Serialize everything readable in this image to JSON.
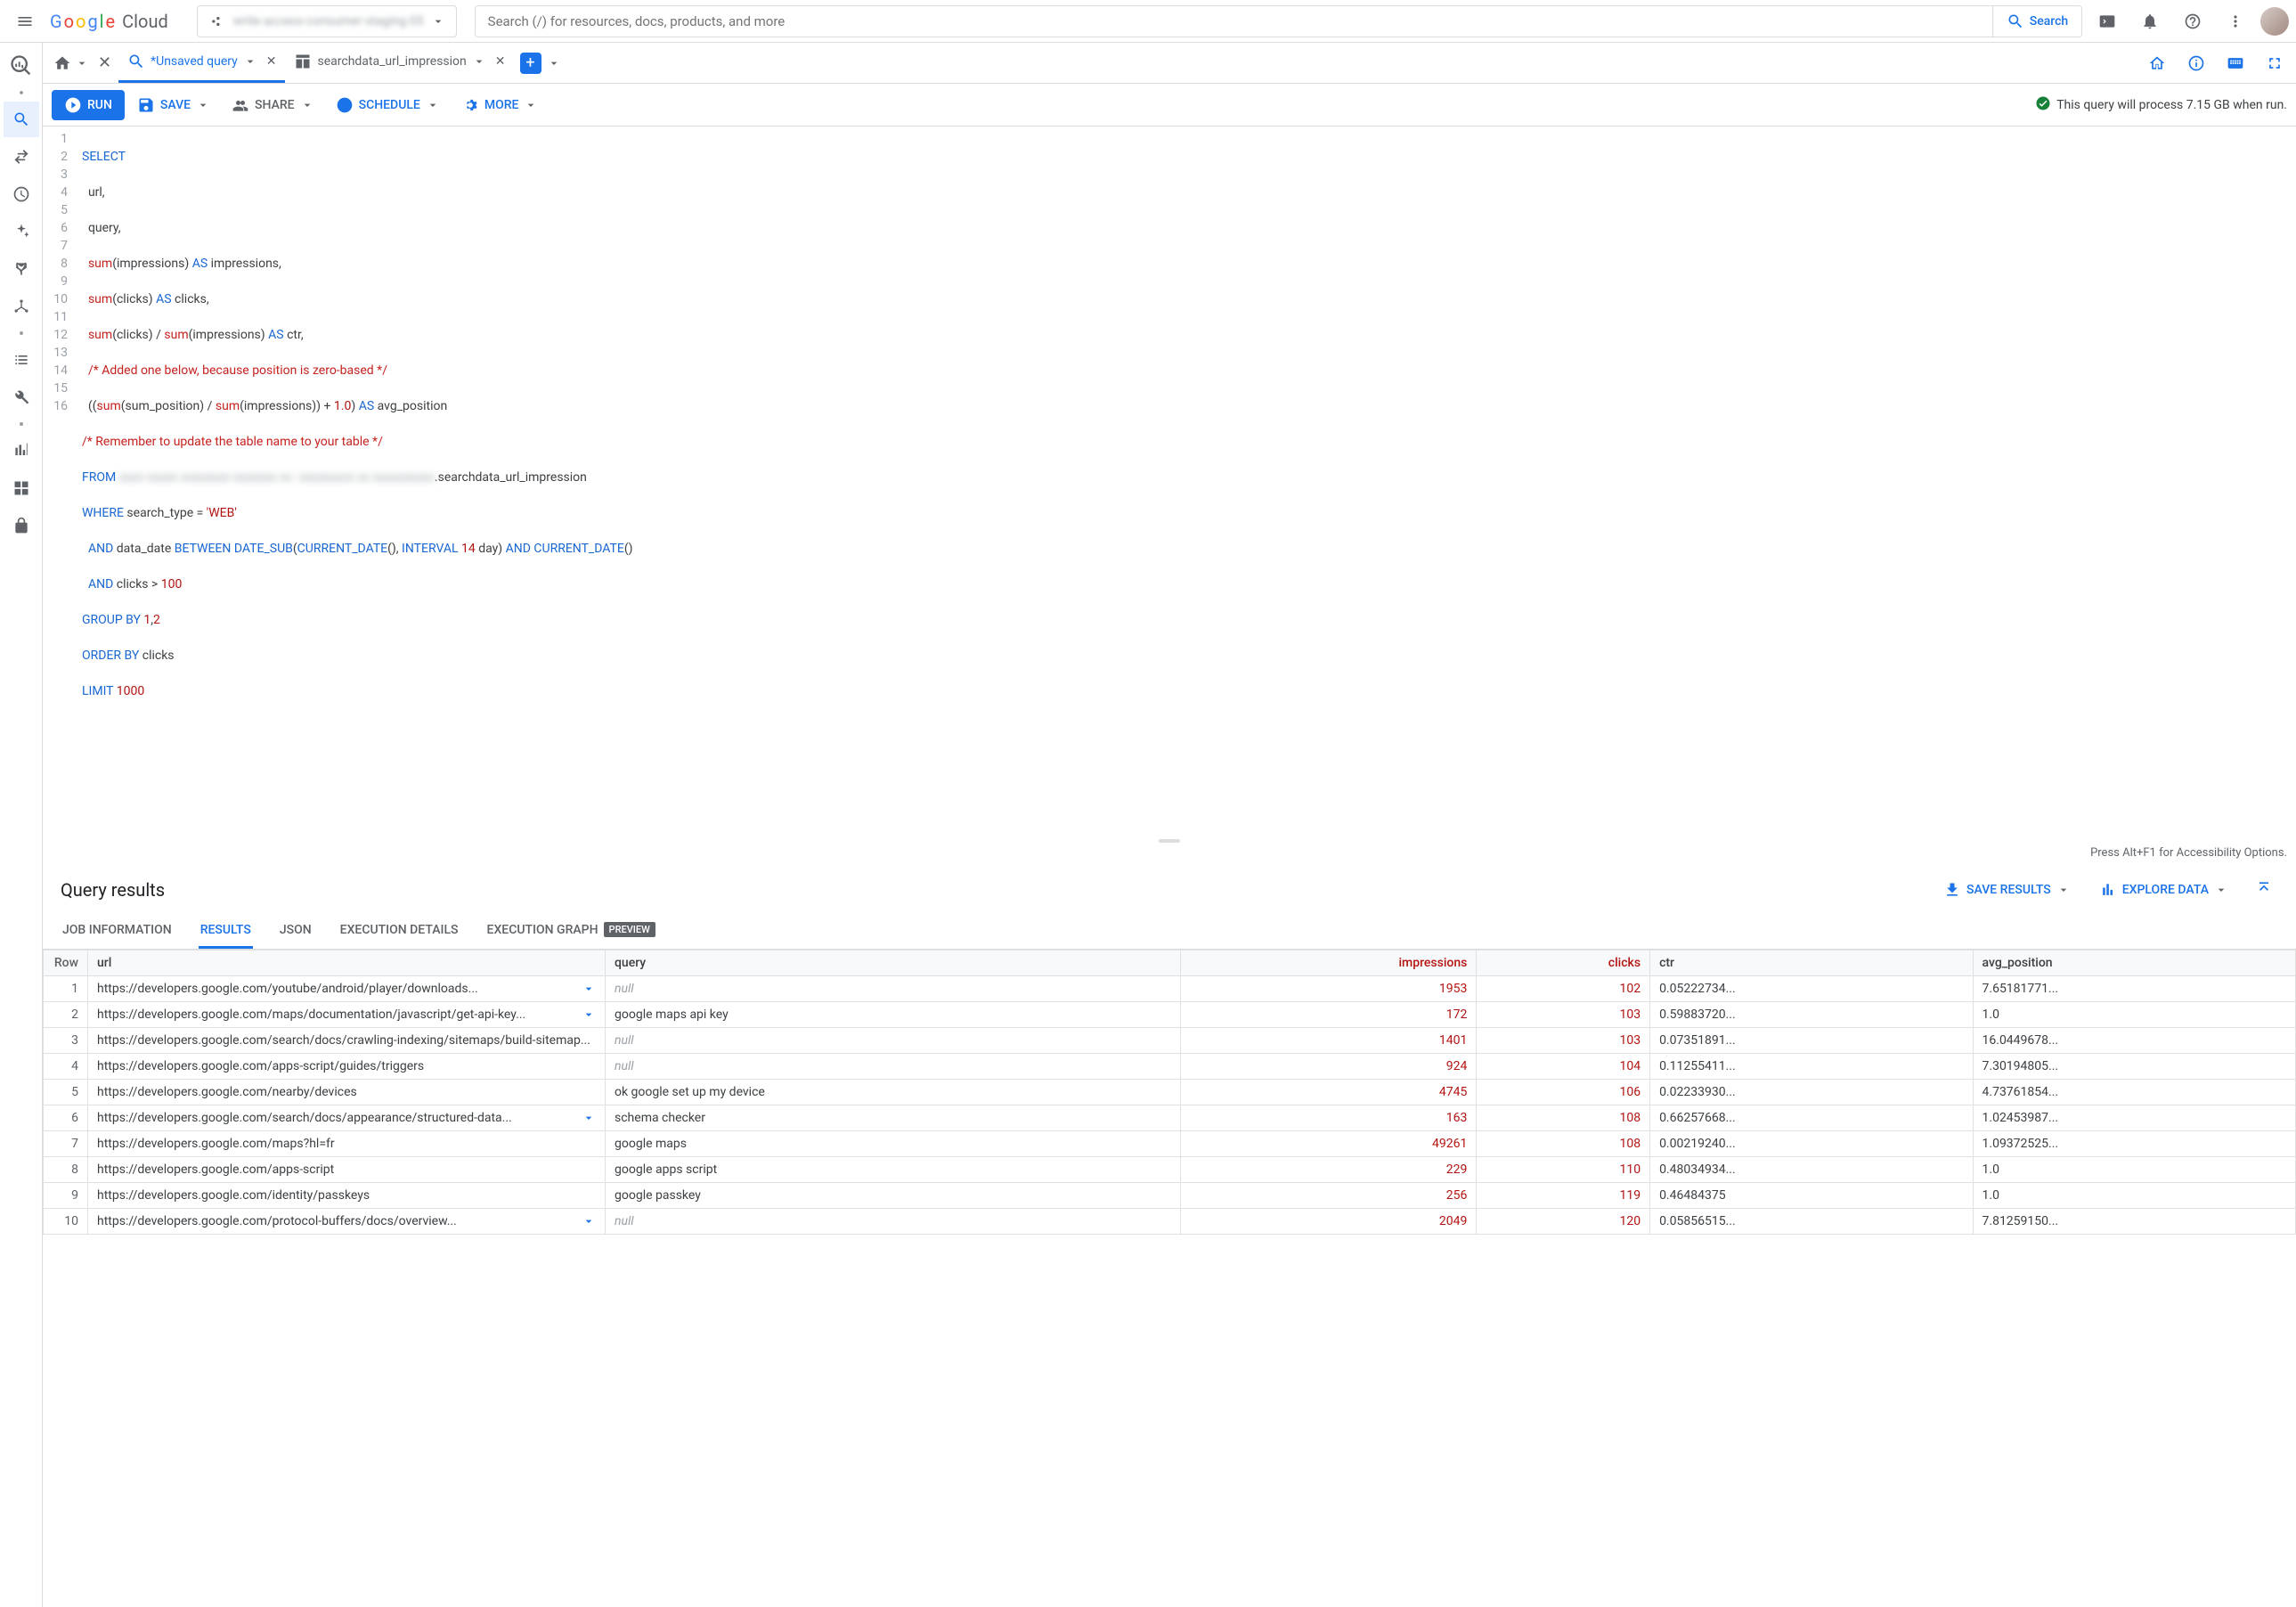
{
  "header": {
    "logo_cloud": "Cloud",
    "project_name": "write·access·consumer·staging·05",
    "search_placeholder": "Search (/) for resources, docs, products, and more",
    "search_button": "Search"
  },
  "tabs": {
    "unsaved": "*Unsaved query",
    "table": "searchdata_url_impression"
  },
  "toolbar": {
    "run": "RUN",
    "save": "SAVE",
    "share": "SHARE",
    "schedule": "SCHEDULE",
    "more": "MORE",
    "validation": "This query will process 7.15 GB when run."
  },
  "editor_hint": "Press Alt+F1 for Accessibility Options.",
  "sql": {
    "l1": "SELECT",
    "l2": "  url,",
    "l3": "  query,",
    "l4a": "  ",
    "l4b": "sum",
    "l4c": "(impressions) ",
    "l4d": "AS",
    "l4e": " impressions,",
    "l5a": "  ",
    "l5b": "sum",
    "l5c": "(clicks) ",
    "l5d": "AS",
    "l5e": " clicks,",
    "l6a": "  ",
    "l6b": "sum",
    "l6c": "(clicks) / ",
    "l6d": "sum",
    "l6e": "(impressions) ",
    "l6f": "AS",
    "l6g": " ctr,",
    "l7": "  /* Added one below, because position is zero-based */",
    "l8a": "  ((",
    "l8b": "sum",
    "l8c": "(sum_position) / ",
    "l8d": "sum",
    "l8e": "(impressions)) + ",
    "l8f": "1.0",
    "l8g": ") ",
    "l8h": "AS",
    "l8i": " avg_position",
    "l9": "/* Remember to update the table name to your table */",
    "l10a": "FROM ",
    "l10b": "xxxx xxxxx xxxxxxxx xxxxxxx xx  xxxxxxxxx xx xxxxxxxxxx",
    "l10c": ".searchdata_url_impression",
    "l11a": "WHERE",
    "l11b": " search_type = ",
    "l11c": "'WEB'",
    "l12a": "  ",
    "l12b": "AND",
    "l12c": " data_date ",
    "l12d": "BETWEEN",
    "l12e": " DATE_SUB",
    "l12f": "(",
    "l12g": "CURRENT_DATE",
    "l12h": "(), ",
    "l12i": "INTERVAL ",
    "l12j": "14",
    "l12k": " day) ",
    "l12l": "AND ",
    "l12m": "CURRENT_DATE",
    "l12n": "()",
    "l13a": "  ",
    "l13b": "AND",
    "l13c": " clicks > ",
    "l13d": "100",
    "l14a": "GROUP BY ",
    "l14b": "1",
    "l14c": ",",
    "l14d": "2",
    "l15a": "ORDER BY ",
    "l15b": "clicks",
    "l16a": "LIMIT ",
    "l16b": "1000"
  },
  "results": {
    "title": "Query results",
    "save_results": "SAVE RESULTS",
    "explore_data": "EXPLORE DATA",
    "tabs": {
      "job": "JOB INFORMATION",
      "results": "RESULTS",
      "json": "JSON",
      "exec": "EXECUTION DETAILS",
      "graph": "EXECUTION GRAPH",
      "preview": "PREVIEW"
    },
    "columns": [
      "Row",
      "url",
      "query",
      "impressions",
      "clicks",
      "ctr",
      "avg_position"
    ],
    "rows": [
      {
        "row": 1,
        "url": "https://developers.google.com/youtube/android/player/downloads...",
        "expand": true,
        "query": null,
        "impressions": 1953,
        "clicks": 102,
        "ctr": "0.05222734...",
        "avg": "7.65181771..."
      },
      {
        "row": 2,
        "url": "https://developers.google.com/maps/documentation/javascript/get-api-key...",
        "expand": true,
        "query": "google maps api key",
        "impressions": 172,
        "clicks": 103,
        "ctr": "0.59883720...",
        "avg": "1.0"
      },
      {
        "row": 3,
        "url": "https://developers.google.com/search/docs/crawling-indexing/sitemaps/build-sitemap...",
        "expand": true,
        "query": null,
        "impressions": 1401,
        "clicks": 103,
        "ctr": "0.07351891...",
        "avg": "16.0449678..."
      },
      {
        "row": 4,
        "url": "https://developers.google.com/apps-script/guides/triggers",
        "expand": false,
        "query": null,
        "impressions": 924,
        "clicks": 104,
        "ctr": "0.11255411...",
        "avg": "7.30194805..."
      },
      {
        "row": 5,
        "url": "https://developers.google.com/nearby/devices",
        "expand": false,
        "query": "ok google set up my device",
        "impressions": 4745,
        "clicks": 106,
        "ctr": "0.02233930...",
        "avg": "4.73761854..."
      },
      {
        "row": 6,
        "url": "https://developers.google.com/search/docs/appearance/structured-data...",
        "expand": true,
        "query": "schema checker",
        "impressions": 163,
        "clicks": 108,
        "ctr": "0.66257668...",
        "avg": "1.02453987..."
      },
      {
        "row": 7,
        "url": "https://developers.google.com/maps?hl=fr",
        "expand": false,
        "query": "google maps",
        "impressions": 49261,
        "clicks": 108,
        "ctr": "0.00219240...",
        "avg": "1.09372525..."
      },
      {
        "row": 8,
        "url": "https://developers.google.com/apps-script",
        "expand": false,
        "query": "google apps script",
        "impressions": 229,
        "clicks": 110,
        "ctr": "0.48034934...",
        "avg": "1.0"
      },
      {
        "row": 9,
        "url": "https://developers.google.com/identity/passkeys",
        "expand": false,
        "query": "google passkey",
        "impressions": 256,
        "clicks": 119,
        "ctr": "0.46484375",
        "avg": "1.0"
      },
      {
        "row": 10,
        "url": "https://developers.google.com/protocol-buffers/docs/overview...",
        "expand": true,
        "query": null,
        "impressions": 2049,
        "clicks": 120,
        "ctr": "0.05856515...",
        "avg": "7.81259150..."
      }
    ]
  }
}
